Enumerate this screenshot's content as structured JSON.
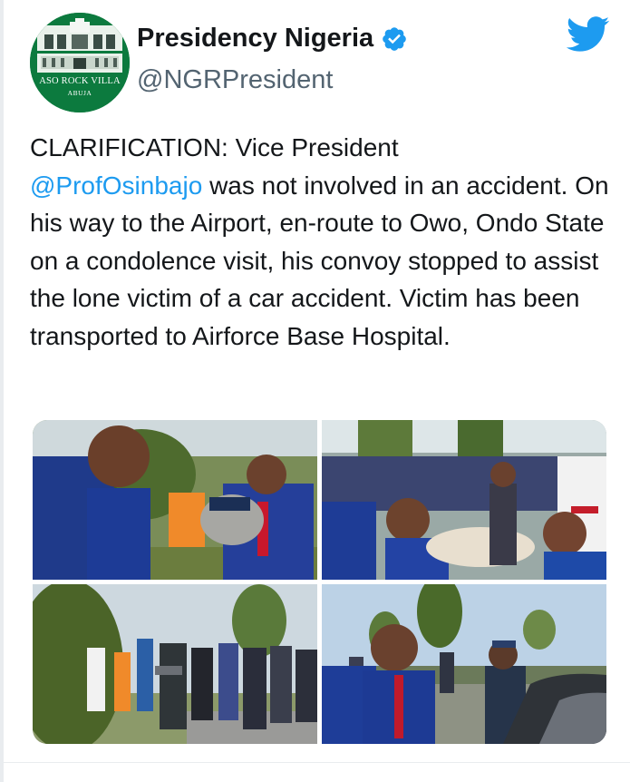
{
  "account": {
    "display_name": "Presidency Nigeria",
    "handle": "@NGRPresident",
    "verified": true,
    "avatar": {
      "line1": "ASO ROCK VILLA",
      "line2": "ABUJA",
      "background": "#0c7a3e"
    }
  },
  "tweet": {
    "prefix": "CLARIFICATION: Vice President",
    "mention": "@ProfOsinbajo",
    "body": "was not involved in an accident. On his way to the Airport, en-route to Owo, Ondo State on a condolence visit, his convoy stopped to assist the lone victim of a car accident. Victim has been transported to Airforce Base Hospital."
  },
  "media": {
    "photo_count": 4
  },
  "icons": {
    "brand": "twitter-bird-icon",
    "verified": "verified-badge-icon"
  },
  "colors": {
    "accent": "#1d9bf0",
    "text": "#14171a",
    "secondary_text": "#536471",
    "logo_green": "#0c7a3e"
  }
}
